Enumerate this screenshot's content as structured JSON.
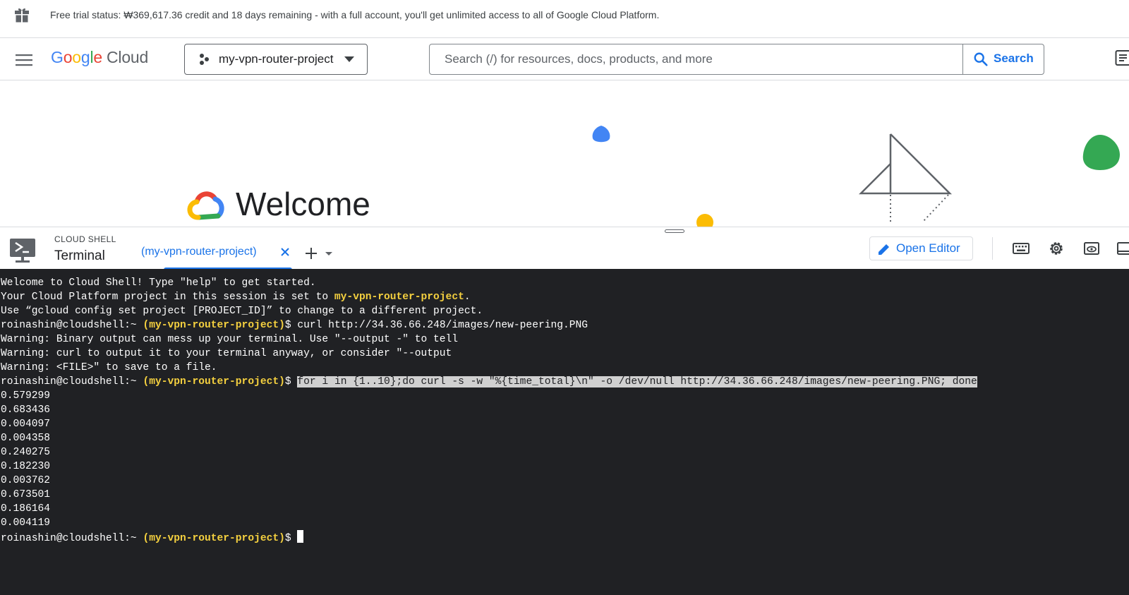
{
  "banner": {
    "text": "Free trial status: ₩369,617.36 credit and 18 days remaining - with a full account, you'll get unlimited access to all of Google Cloud Platform.",
    "icon": "gift-icon"
  },
  "header": {
    "logo_google": "Google",
    "logo_cloud": "Cloud",
    "project_name": "my-vpn-router-project",
    "search_placeholder": "Search (/) for resources, docs, products, and more",
    "search_label": "Search"
  },
  "welcome": {
    "title": "Welcome"
  },
  "shell": {
    "kicker": "CLOUD SHELL",
    "title": "Terminal",
    "tab_label": "(my-vpn-router-project)",
    "open_editor_label": "Open Editor"
  },
  "terminal": {
    "prompt_user": "roinashin@cloudshell:~",
    "prompt_project": "(my-vpn-router-project)",
    "prompt_symbol": "$",
    "welcome_line": "Welcome to Cloud Shell! Type \"help\" to get started.",
    "project_line_prefix": "Your Cloud Platform project in this session is set to ",
    "project_line_project": "my-vpn-router-project",
    "project_line_suffix": ".",
    "gcloud_line": "Use “gcloud config set project [PROJECT_ID]” to change to a different project.",
    "cmd1": " curl http://34.36.66.248/images/new-peering.PNG",
    "warn1": "Warning: Binary output can mess up your terminal. Use \"--output -\" to tell",
    "warn2": "Warning: curl to output it to your terminal anyway, or consider \"--output",
    "warn3": "Warning: <FILE>\" to save to a file.",
    "cmd2": "for i in {1..10};do curl -s -w \"%{time_total}\\n\" -o /dev/null http://34.36.66.248/images/new-peering.PNG; done",
    "timings": [
      "0.579299",
      "0.683436",
      "0.004097",
      "0.004358",
      "0.240275",
      "0.182230",
      "0.003762",
      "0.673501",
      "0.186164",
      "0.004119"
    ]
  },
  "colors": {
    "accent": "#1a73e8",
    "terminal_bg": "#202124",
    "prompt_project": "#f4d03f"
  }
}
